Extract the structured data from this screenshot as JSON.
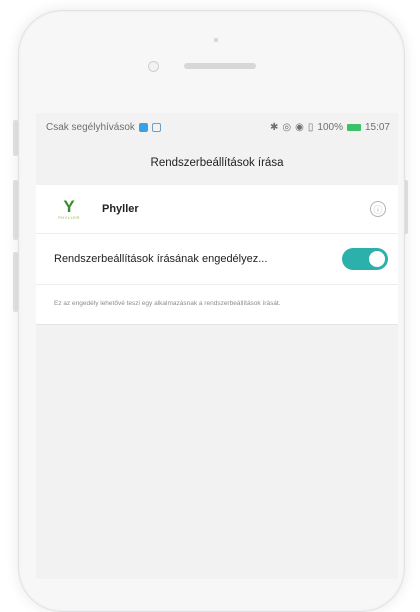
{
  "status_bar": {
    "carrier": "Csak segélyhívások",
    "battery_percent": "100%",
    "time": "15:07",
    "battery_color": "#3cc16a"
  },
  "screen": {
    "title": "Rendszerbeállítások írása"
  },
  "app": {
    "name": "Phyller",
    "logo_mark": "Y",
    "logo_word": "PHYLLER",
    "logo_color": "#3b8a2e"
  },
  "permission": {
    "label": "Rendszerbeállítások írásának engedélyez...",
    "enabled": true,
    "toggle_color": "#2bb0ac",
    "description": "Ez az engedély lehetővé teszi egy alkalmazásnak a rendszerbeállítások írását."
  },
  "icons": {
    "info": "ⓘ"
  }
}
